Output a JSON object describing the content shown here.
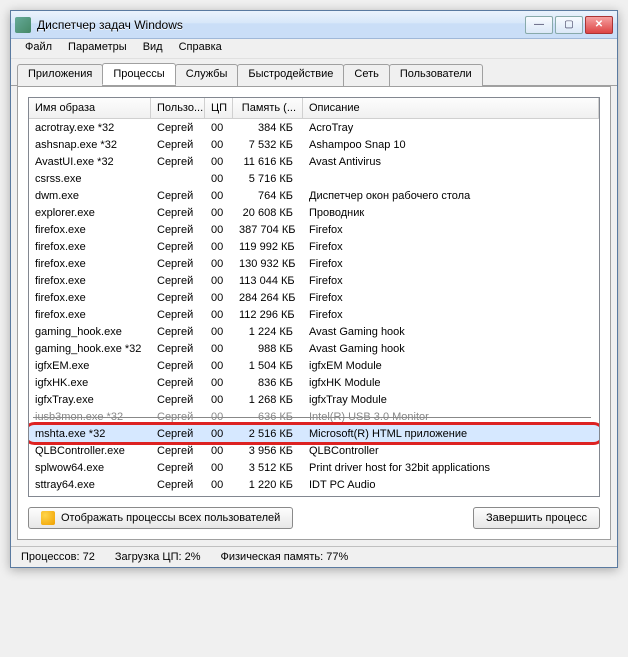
{
  "window": {
    "title": "Диспетчер задач Windows"
  },
  "menu": [
    "Файл",
    "Параметры",
    "Вид",
    "Справка"
  ],
  "tabs": [
    "Приложения",
    "Процессы",
    "Службы",
    "Быстродействие",
    "Сеть",
    "Пользователи"
  ],
  "active_tab": 1,
  "columns": {
    "image": "Имя образа",
    "user": "Пользо...",
    "cpu": "ЦП",
    "mem": "Память (...",
    "desc": "Описание"
  },
  "rows": [
    {
      "image": "acrotray.exe *32",
      "user": "Сергей",
      "cpu": "00",
      "mem": "384 КБ",
      "desc": "AcroTray"
    },
    {
      "image": "ashsnap.exe *32",
      "user": "Сергей",
      "cpu": "00",
      "mem": "7 532 КБ",
      "desc": "Ashampoo Snap 10"
    },
    {
      "image": "AvastUI.exe *32",
      "user": "Сергей",
      "cpu": "00",
      "mem": "11 616 КБ",
      "desc": "Avast Antivirus"
    },
    {
      "image": "csrss.exe",
      "user": "",
      "cpu": "00",
      "mem": "5 716 КБ",
      "desc": ""
    },
    {
      "image": "dwm.exe",
      "user": "Сергей",
      "cpu": "00",
      "mem": "764 КБ",
      "desc": "Диспетчер окон рабочего стола"
    },
    {
      "image": "explorer.exe",
      "user": "Сергей",
      "cpu": "00",
      "mem": "20 608 КБ",
      "desc": "Проводник"
    },
    {
      "image": "firefox.exe",
      "user": "Сергей",
      "cpu": "00",
      "mem": "387 704 КБ",
      "desc": "Firefox"
    },
    {
      "image": "firefox.exe",
      "user": "Сергей",
      "cpu": "00",
      "mem": "119 992 КБ",
      "desc": "Firefox"
    },
    {
      "image": "firefox.exe",
      "user": "Сергей",
      "cpu": "00",
      "mem": "130 932 КБ",
      "desc": "Firefox"
    },
    {
      "image": "firefox.exe",
      "user": "Сергей",
      "cpu": "00",
      "mem": "113 044 КБ",
      "desc": "Firefox"
    },
    {
      "image": "firefox.exe",
      "user": "Сергей",
      "cpu": "00",
      "mem": "284 264 КБ",
      "desc": "Firefox"
    },
    {
      "image": "firefox.exe",
      "user": "Сергей",
      "cpu": "00",
      "mem": "112 296 КБ",
      "desc": "Firefox"
    },
    {
      "image": "gaming_hook.exe",
      "user": "Сергей",
      "cpu": "00",
      "mem": "1 224 КБ",
      "desc": "Avast Gaming hook"
    },
    {
      "image": "gaming_hook.exe *32",
      "user": "Сергей",
      "cpu": "00",
      "mem": "988 КБ",
      "desc": "Avast Gaming hook"
    },
    {
      "image": "igfxEM.exe",
      "user": "Сергей",
      "cpu": "00",
      "mem": "1 504 КБ",
      "desc": "igfxEM Module"
    },
    {
      "image": "igfxHK.exe",
      "user": "Сергей",
      "cpu": "00",
      "mem": "836 КБ",
      "desc": "igfxHK Module"
    },
    {
      "image": "igfxTray.exe",
      "user": "Сергей",
      "cpu": "00",
      "mem": "1 268 КБ",
      "desc": "igfxTray Module"
    },
    {
      "image": "iusb3mon.exe *32",
      "user": "Сергей",
      "cpu": "00",
      "mem": "636 КБ",
      "desc": "Intel(R) USB 3.0 Monitor",
      "deleted": true
    },
    {
      "image": "mshta.exe *32",
      "user": "Сергей",
      "cpu": "00",
      "mem": "2 516 КБ",
      "desc": "Microsoft(R) HTML приложение",
      "selected": true,
      "highlighted": true
    },
    {
      "image": "QLBController.exe",
      "user": "Сергей",
      "cpu": "00",
      "mem": "3 956 КБ",
      "desc": "QLBController"
    },
    {
      "image": "splwow64.exe",
      "user": "Сергей",
      "cpu": "00",
      "mem": "3 512 КБ",
      "desc": "Print driver host for 32bit applications"
    },
    {
      "image": "sttray64.exe",
      "user": "Сергей",
      "cpu": "00",
      "mem": "1 220 КБ",
      "desc": "IDT PC Audio"
    }
  ],
  "buttons": {
    "show_all": "Отображать процессы всех пользователей",
    "end": "Завершить процесс"
  },
  "status": {
    "proc_label": "Процессов:",
    "proc_val": "72",
    "cpu_label": "Загрузка ЦП:",
    "cpu_val": "2%",
    "mem_label": "Физическая память:",
    "mem_val": "77%"
  }
}
